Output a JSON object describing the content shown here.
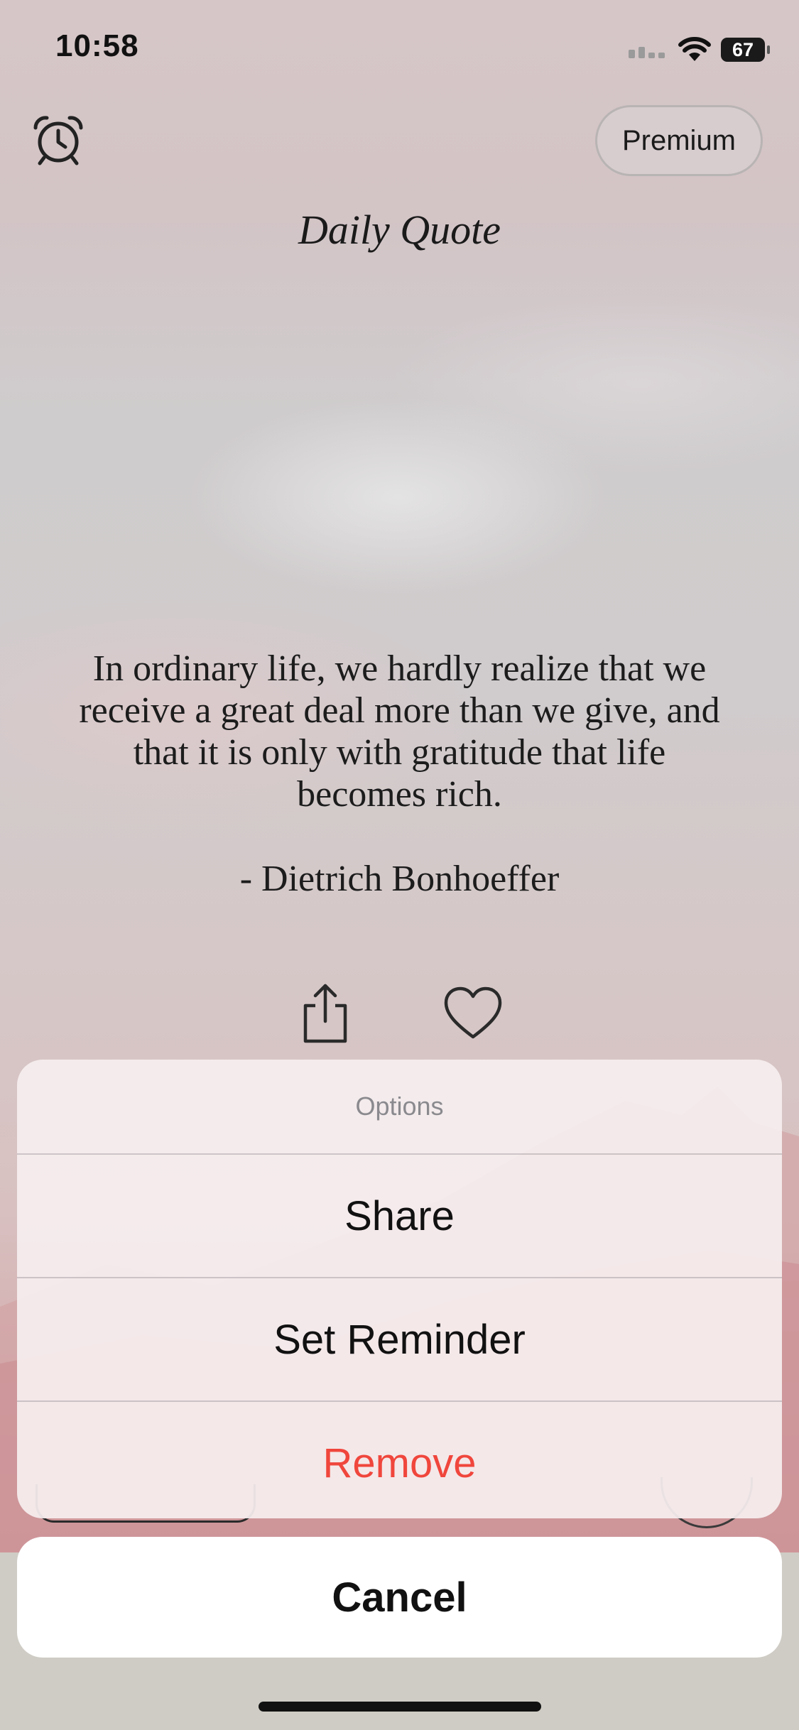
{
  "status_bar": {
    "time": "10:58",
    "battery": "67"
  },
  "header": {
    "premium_label": "Premium",
    "title": "Daily Quote"
  },
  "quote": {
    "text": "In ordinary life, we hardly realize that we receive a great deal more than we give, and that it is only with gratitude that life becomes rich.",
    "author": "- Dietrich Bonhoeffer"
  },
  "action_sheet": {
    "title": "Options",
    "items": [
      {
        "label": "Share"
      },
      {
        "label": "Set Reminder"
      },
      {
        "label": "Remove"
      }
    ],
    "cancel_label": "Cancel"
  },
  "icons": {
    "alarm": "alarm-clock-icon",
    "share": "share-icon",
    "favorite": "heart-icon"
  },
  "colors": {
    "destructive": "#f0463c",
    "sheet_title": "#8a8a8e"
  }
}
